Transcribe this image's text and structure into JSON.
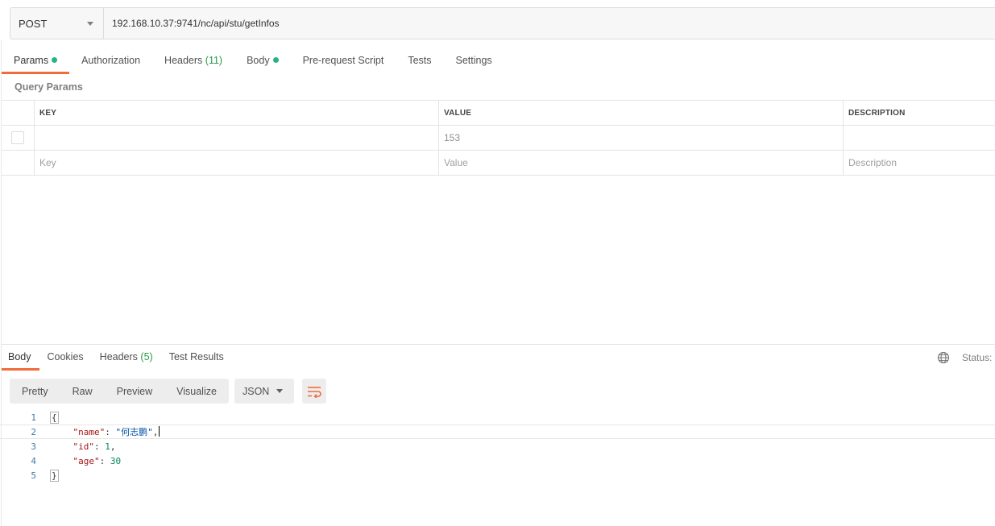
{
  "request": {
    "method": "POST",
    "url": "192.168.10.37:9741/nc/api/stu/getInfos"
  },
  "request_tabs": [
    {
      "label": "Params",
      "dot": true,
      "active": true
    },
    {
      "label": "Authorization"
    },
    {
      "label": "Headers",
      "count": "(11)"
    },
    {
      "label": "Body",
      "dot": true
    },
    {
      "label": "Pre-request Script"
    },
    {
      "label": "Tests"
    },
    {
      "label": "Settings"
    }
  ],
  "query_params": {
    "title": "Query Params",
    "columns": {
      "key": "KEY",
      "value": "VALUE",
      "description": "DESCRIPTION"
    },
    "row": {
      "key": "",
      "value": "153",
      "description": ""
    },
    "placeholders": {
      "key": "Key",
      "value": "Value",
      "description": "Description"
    }
  },
  "response_tabs": [
    {
      "label": "Body",
      "active": true
    },
    {
      "label": "Cookies"
    },
    {
      "label": "Headers",
      "count": "(5)"
    },
    {
      "label": "Test Results"
    }
  ],
  "status_label": "Status:",
  "view_modes": [
    "Pretty",
    "Raw",
    "Preview",
    "Visualize"
  ],
  "format": "JSON",
  "code_lines": [
    {
      "num": "1"
    },
    {
      "num": "2",
      "key": "\"name\"",
      "value": "\"何志鹏\"",
      "tail": ","
    },
    {
      "num": "3",
      "key": "\"id\"",
      "value": "1",
      "tail": ","
    },
    {
      "num": "4",
      "key": "\"age\"",
      "value": "30",
      "tail": ""
    },
    {
      "num": "5"
    }
  ],
  "code_braces": {
    "open": "{",
    "close": "}"
  },
  "code_punct": {
    "colon": ": "
  },
  "colors": {
    "accent": "#f26b3a",
    "count_green": "#2a9a48",
    "dot_green": "#26b47f",
    "json_key": "#a31515",
    "json_string": "#0451a5",
    "json_number": "#098658"
  },
  "icons": {
    "globe": "globe-icon",
    "wrap": "wrap-lines-icon",
    "method_caret": "chevron-down-icon",
    "format_caret": "chevron-down-icon"
  }
}
